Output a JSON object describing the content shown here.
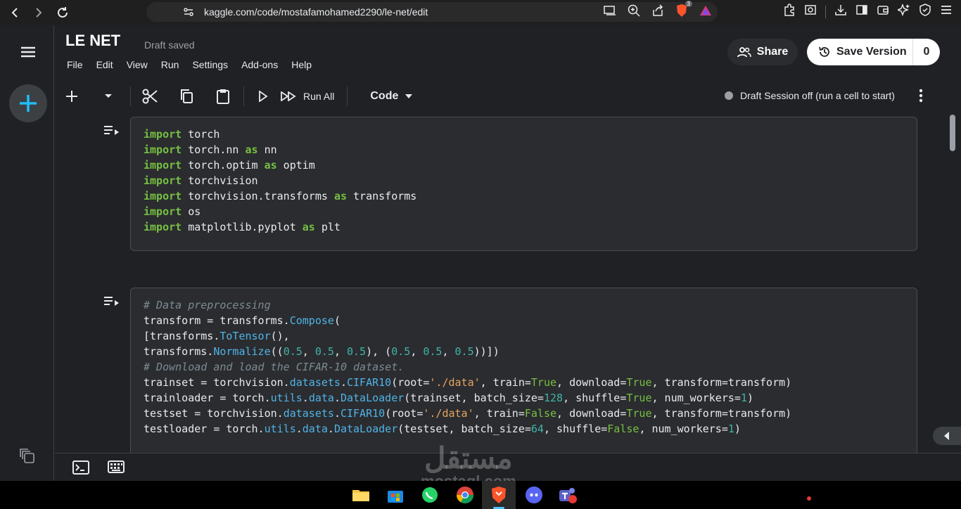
{
  "browser": {
    "url": "kaggle.com/code/mostafamohamed2290/le-net/edit",
    "brave_badge": "3"
  },
  "notebook": {
    "title": "LE NET",
    "save_status": "Draft saved",
    "menu": [
      "File",
      "Edit",
      "View",
      "Run",
      "Settings",
      "Add-ons",
      "Help"
    ],
    "share_label": "Share",
    "save_version_label": "Save Version",
    "save_version_count": "0"
  },
  "toolbar": {
    "run_all_label": "Run All",
    "cell_type": "Code",
    "session_status": "Draft Session off (run a cell to start)"
  },
  "cells": [
    {
      "type": "code",
      "lines": [
        "import torch",
        "import torch.nn as nn",
        "import torch.optim as optim",
        "import torchvision",
        "import torchvision.transforms as transforms",
        "import os",
        "import matplotlib.pyplot as plt"
      ]
    },
    {
      "type": "code",
      "lines": [
        "# Data preprocessing",
        "transform = transforms.Compose(",
        "[transforms.ToTensor(),",
        "transforms.Normalize((0.5, 0.5, 0.5), (0.5, 0.5, 0.5))])",
        "# Download and load the CIFAR-10 dataset.",
        "trainset = torchvision.datasets.CIFAR10(root='./data', train=True, download=True, transform=transform)",
        "trainloader = torch.utils.data.DataLoader(trainset, batch_size=128, shuffle=True, num_workers=1)",
        "testset = torchvision.datasets.CIFAR10(root='./data', train=False, download=True, transform=transform)",
        "testloader = torch.utils.data.DataLoader(testset, batch_size=64, shuffle=False, num_workers=1)"
      ]
    }
  ],
  "watermark": {
    "arabic": "مستقل",
    "latin": "mostaql.com"
  },
  "colors": {
    "keyword": "#76c043",
    "attribute": "#4fb3e9",
    "number": "#3fb4a8",
    "string": "#e5a463",
    "comment": "#7c8b94",
    "accent": "#20beff"
  }
}
